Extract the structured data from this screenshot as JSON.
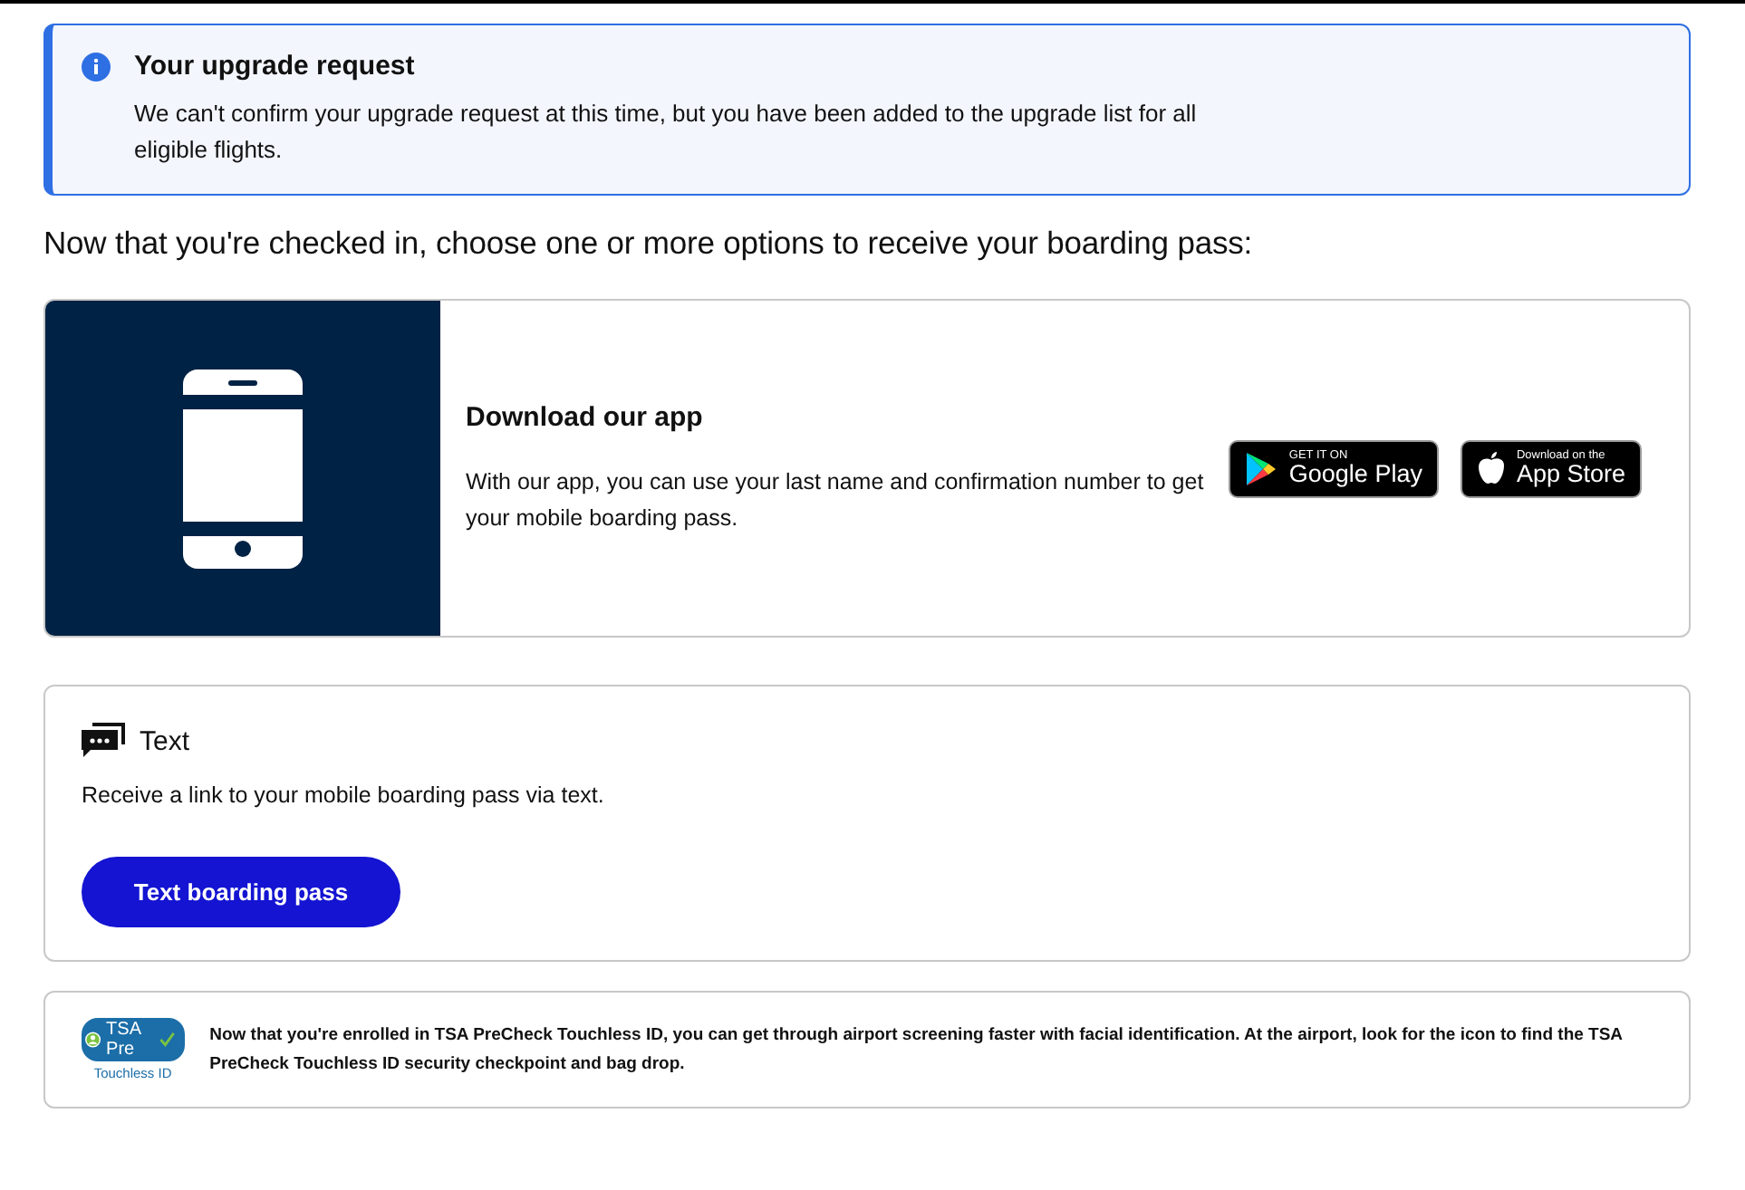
{
  "alert": {
    "kind": "info",
    "title": "Your upgrade request",
    "message": "We can't confirm your upgrade request at this time, but you have been added to the upgrade list for all eligible flights."
  },
  "heading": "Now that you're checked in, choose one or more options to receive your boarding pass:",
  "app_card": {
    "title": "Download our app",
    "description": "With our app, you can use your last name and confirmation number to get your mobile boarding pass.",
    "badges": [
      {
        "kind": "google",
        "small": "GET IT ON",
        "large": "Google Play"
      },
      {
        "kind": "apple",
        "small": "Download on the",
        "large": "App Store"
      }
    ]
  },
  "text_card": {
    "title": "Text",
    "description": "Receive a link to your mobile boarding pass via text.",
    "button": "Text boarding pass"
  },
  "tsa_card": {
    "logo_text": "TSA Pre",
    "logo_caption": "Touchless ID",
    "message": "Now that you're enrolled in TSA PreCheck Touchless ID, you can get through airport screening faster with facial identification. At the airport, look for the icon to find the TSA PreCheck Touchless ID security checkpoint and bag drop."
  }
}
